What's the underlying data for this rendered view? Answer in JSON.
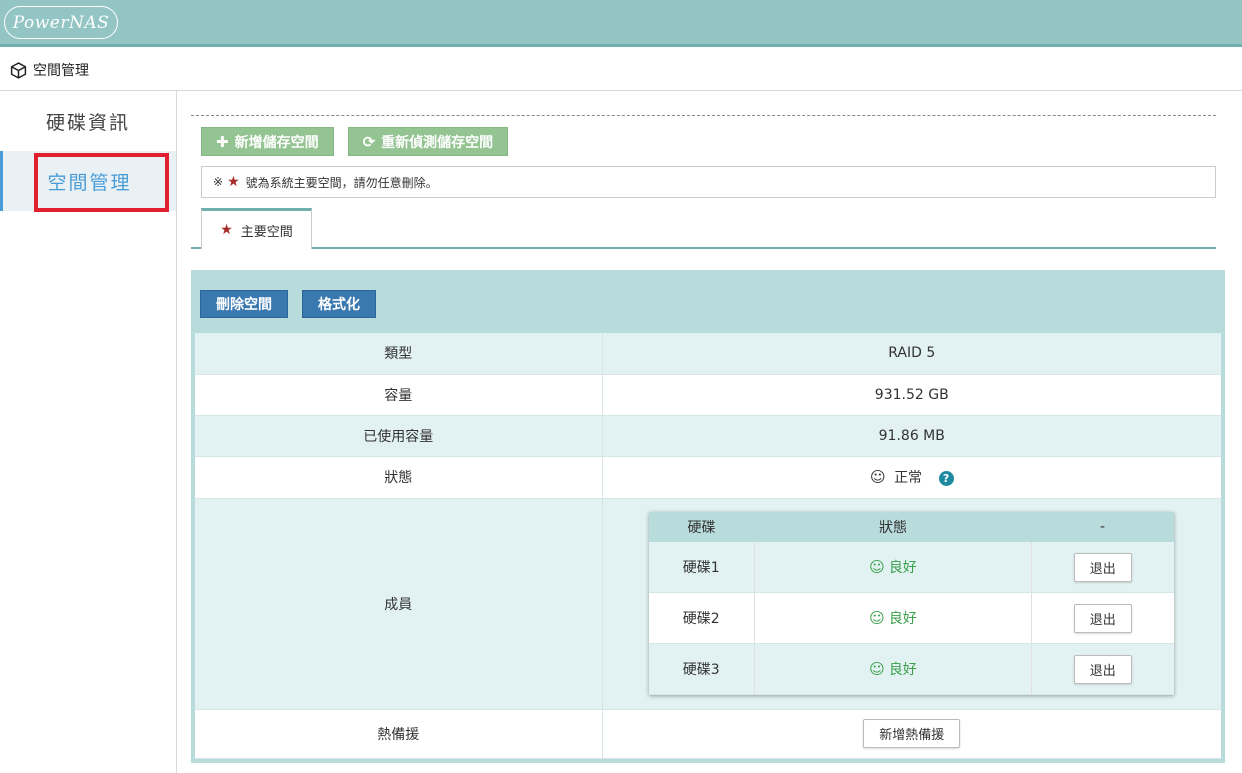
{
  "header": {
    "logo_text": "PowerNAS"
  },
  "breadcrumb": {
    "icon": "cube-icon",
    "title": "空間管理"
  },
  "sidebar": {
    "items": [
      {
        "label": "硬碟資訊",
        "active": false
      },
      {
        "label": "空間管理",
        "active": true
      }
    ]
  },
  "toolbar": {
    "add_label": "新增儲存空間",
    "rescan_label": "重新偵測儲存空間"
  },
  "notice": {
    "prefix": "※",
    "text": "號為系統主要空間，請勿任意刪除。"
  },
  "tabs": [
    {
      "label": "主要空間"
    }
  ],
  "panel": {
    "delete_label": "刪除空間",
    "format_label": "格式化",
    "rows": {
      "type_label": "類型",
      "type_value": "RAID 5",
      "capacity_label": "容量",
      "capacity_value": "931.52 GB",
      "used_label": "已使用容量",
      "used_value": "91.86 MB",
      "status_label": "狀態",
      "status_value": "正常",
      "members_label": "成員",
      "hotspare_label": "熱備援",
      "hotspare_button": "新增熱備援"
    },
    "members": {
      "headers": [
        "硬碟",
        "狀態",
        "-"
      ],
      "rows": [
        {
          "disk": "硬碟1",
          "status": "良好",
          "action": "退出"
        },
        {
          "disk": "硬碟2",
          "status": "良好",
          "action": "退出"
        },
        {
          "disk": "硬碟3",
          "status": "良好",
          "action": "退出"
        }
      ]
    }
  },
  "colors": {
    "header_bg": "#93c5c4",
    "accent_teal": "#6fb0ae",
    "green_button": "#93c492",
    "blue_button": "#3a78b0",
    "highlight_red": "#e0202e",
    "status_good": "#3aa04a"
  }
}
